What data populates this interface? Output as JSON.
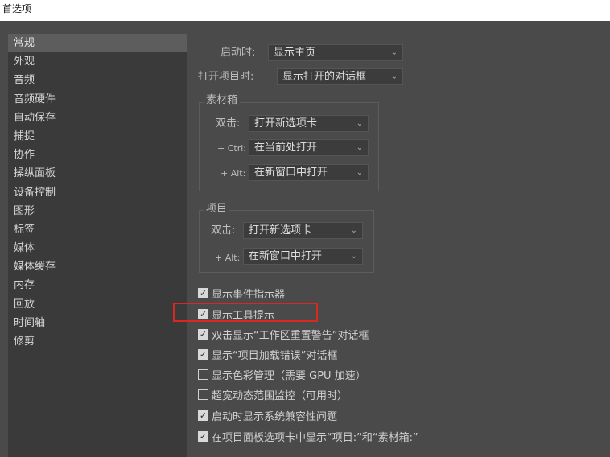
{
  "window": {
    "title": "首选项"
  },
  "sidebar": {
    "items": [
      {
        "label": "常规",
        "selected": true
      },
      {
        "label": "外观",
        "selected": false
      },
      {
        "label": "音频",
        "selected": false
      },
      {
        "label": "音频硬件",
        "selected": false
      },
      {
        "label": "自动保存",
        "selected": false
      },
      {
        "label": "捕捉",
        "selected": false
      },
      {
        "label": "协作",
        "selected": false
      },
      {
        "label": "操纵面板",
        "selected": false
      },
      {
        "label": "设备控制",
        "selected": false
      },
      {
        "label": "图形",
        "selected": false
      },
      {
        "label": "标签",
        "selected": false
      },
      {
        "label": "媒体",
        "selected": false
      },
      {
        "label": "媒体缓存",
        "selected": false
      },
      {
        "label": "内存",
        "selected": false
      },
      {
        "label": "回放",
        "selected": false
      },
      {
        "label": "时间轴",
        "selected": false
      },
      {
        "label": "修剪",
        "selected": false
      }
    ]
  },
  "general": {
    "startup": {
      "label": "启动时:",
      "value": "显示主页"
    },
    "open_project": {
      "label": "打开项目时:",
      "value": "显示打开的对话框"
    },
    "bin": {
      "title": "素材箱",
      "double_click": {
        "label": "双击:",
        "value": "打开新选项卡"
      },
      "ctrl": {
        "label": "+ Ctrl:",
        "value": "在当前处打开"
      },
      "alt": {
        "label": "+ Alt:",
        "value": "在新窗口中打开"
      }
    },
    "project": {
      "title": "项目",
      "double_click": {
        "label": "双击:",
        "value": "打开新选项卡"
      },
      "alt": {
        "label": "+ Alt:",
        "value": "在新窗口中打开"
      }
    },
    "checkboxes": [
      {
        "label": "显示事件指示器",
        "checked": true
      },
      {
        "label": "显示工具提示",
        "checked": true
      },
      {
        "label": "双击显示“工作区重置警告”对话框",
        "checked": true
      },
      {
        "label": "显示“项目加载错误”对话框",
        "checked": true
      },
      {
        "label": "显示色彩管理（需要 GPU 加速）",
        "checked": false
      },
      {
        "label": "超宽动态范围监控（可用时）",
        "checked": false
      },
      {
        "label": "启动时显示系统兼容性问题",
        "checked": true
      },
      {
        "label": "在项目面板选项卡中显示“项目:”和“素材箱:”",
        "checked": true
      }
    ]
  },
  "colors": {
    "background": "#4a4a4a",
    "sidebar": "#3a3a3a",
    "selected": "#5d5d5d",
    "highlight": "#d8281f"
  }
}
